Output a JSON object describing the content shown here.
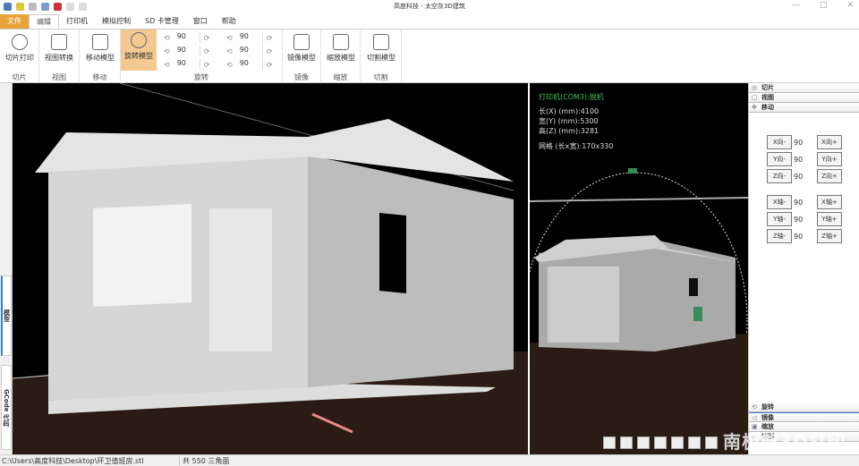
{
  "window": {
    "title": "高度科技 - 太空灰3D建筑"
  },
  "tabs": [
    "文件",
    "编辑",
    "打印机",
    "模拟控制",
    "SD 卡管理",
    "窗口",
    "帮助"
  ],
  "ribbon": {
    "groups": [
      {
        "label": "切片",
        "buttons": [
          "切片打印"
        ]
      },
      {
        "label": "视图",
        "buttons": [
          "视图转换"
        ]
      },
      {
        "label": "移动",
        "buttons": [
          "移动模型"
        ]
      },
      {
        "label": "旋转",
        "buttons": [
          "旋转模型"
        ]
      },
      {
        "label": "镜像",
        "buttons": [
          "镜像模型"
        ]
      },
      {
        "label": "缩放",
        "buttons": [
          "缩放模型"
        ]
      },
      {
        "label": "切割",
        "buttons": [
          "切割模型"
        ]
      }
    ],
    "rotate_values": [
      "90",
      "90",
      "90",
      "90",
      "90",
      "90"
    ]
  },
  "left_tabs": [
    "模型",
    "GCode 代码"
  ],
  "preview": {
    "printer": "打印机(COM3):脱机",
    "length": "长(X) (mm):4100",
    "width": "宽(Y) (mm):5300",
    "height": "高(Z) (mm):3281",
    "grid": "网格 (长x宽):170x330"
  },
  "panel": {
    "headers": [
      "切片",
      "视图",
      "移动"
    ],
    "rows": [
      {
        "minus": "X向-",
        "value": "90",
        "plus": "X向+"
      },
      {
        "minus": "Y向-",
        "value": "90",
        "plus": "Y向+"
      },
      {
        "minus": "Z向-",
        "value": "90",
        "plus": "Z向+"
      },
      {
        "minus": "X轴-",
        "value": "90",
        "plus": "X轴+"
      },
      {
        "minus": "Y轴-",
        "value": "90",
        "plus": "Y轴+"
      },
      {
        "minus": "Z轴-",
        "value": "90",
        "plus": "Z轴+"
      }
    ],
    "bottom_headers": [
      "旋转",
      "镜像",
      "缩放",
      "切割"
    ]
  },
  "watermark": "南极熊3D打印",
  "status": {
    "path": "C:\\Users\\高度科技\\Desktop\\环卫值班房.stl",
    "triangles": "共 550 三角面"
  },
  "colors": {
    "accent": "#e8a33a",
    "selected": "#f3c98f",
    "info_green": "#3fbf5f"
  }
}
